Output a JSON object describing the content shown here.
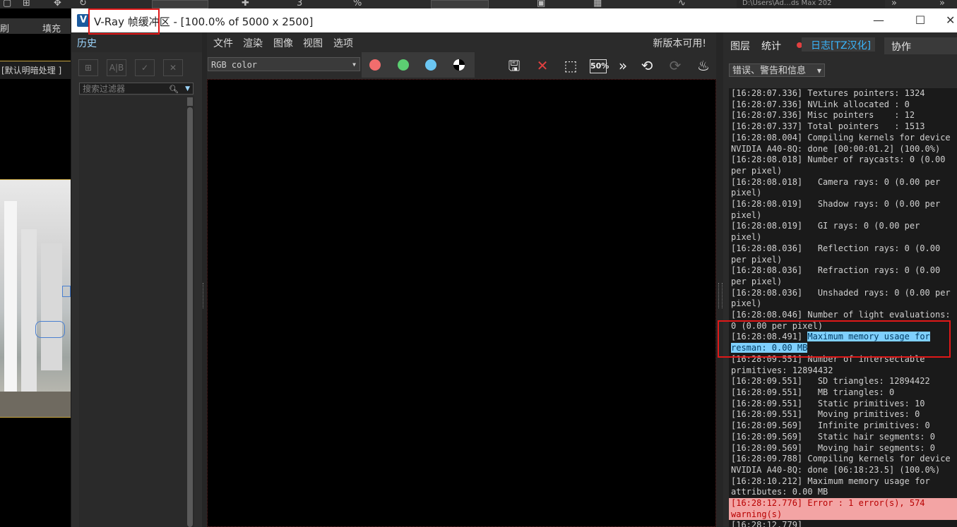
{
  "host": {
    "path_fragment": "D:\\Users\\Ad…ds Max 202",
    "left_menu": [
      "刷",
      "填充"
    ],
    "viewport_label": "[默认明暗处理 ]"
  },
  "window": {
    "title": "V-Ray 帧缓冲区 - [100.0% of 5000 x 2500]",
    "logo": "V",
    "minimize": "—",
    "maximize": "☐",
    "close": "✕"
  },
  "history": {
    "tab": "历史",
    "search_placeholder": "搜索过滤器"
  },
  "menu": {
    "items": [
      "文件",
      "渲染",
      "图像",
      "视图",
      "选项"
    ],
    "update_notice": "新版本可用!"
  },
  "toolbar": {
    "channel": "RGB color",
    "zoom_label": "50%",
    "colors": {
      "red": "#f26d6d",
      "green": "#5ccf72",
      "blue": "#6bc6f2"
    }
  },
  "log_panel": {
    "tabs": [
      "图层",
      "统计",
      "日志[TZ汉化]",
      "协作"
    ],
    "filter": "错误、警告和信息",
    "lines": [
      {
        "text": "[16:28:07.336] Textures pointers: 1324"
      },
      {
        "text": "[16:28:07.336] NVLink allocated : 0"
      },
      {
        "text": "[16:28:07.336] Misc pointers    : 12"
      },
      {
        "text": "[16:28:07.337] Total pointers   : 1513"
      },
      {
        "text": "[16:28:08.004] Compiling kernels for device"
      },
      {
        "text": "NVIDIA A40-8Q: done [00:00:01.2] (100.0%)"
      },
      {
        "text": "[16:28:08.018] Number of raycasts: 0 (0.00"
      },
      {
        "text": "per pixel)"
      },
      {
        "text": "[16:28:08.018]   Camera rays: 0 (0.00 per"
      },
      {
        "text": "pixel)"
      },
      {
        "text": "[16:28:08.019]   Shadow rays: 0 (0.00 per"
      },
      {
        "text": "pixel)"
      },
      {
        "text": "[16:28:08.019]   GI rays: 0 (0.00 per"
      },
      {
        "text": "pixel)"
      },
      {
        "text": "[16:28:08.036]   Reflection rays: 0 (0.00"
      },
      {
        "text": "per pixel)"
      },
      {
        "text": "[16:28:08.036]   Refraction rays: 0 (0.00"
      },
      {
        "text": "per pixel)"
      },
      {
        "text": "[16:28:08.036]   Unshaded rays: 0 (0.00 per"
      },
      {
        "text": "pixel)"
      },
      {
        "text": "[16:28:08.046] Number of light evaluations:"
      },
      {
        "text": "0 (0.00 per pixel)"
      },
      {
        "prefix": "[16:28:08.491] ",
        "selected": "Maximum memory usage for"
      },
      {
        "prefix": "",
        "selected": "resman: 0.00 MB"
      },
      {
        "text": "[16:28:09.551] Number of intersectable"
      },
      {
        "text": "primitives: 12894432"
      },
      {
        "text": "[16:28:09.551]   SD triangles: 12894422"
      },
      {
        "text": "[16:28:09.551]   MB triangles: 0"
      },
      {
        "text": "[16:28:09.551]   Static primitives: 10"
      },
      {
        "text": "[16:28:09.551]   Moving primitives: 0"
      },
      {
        "text": "[16:28:09.569]   Infinite primitives: 0"
      },
      {
        "text": "[16:28:09.569]   Static hair segments: 0"
      },
      {
        "text": "[16:28:09.569]   Moving hair segments: 0"
      },
      {
        "text": "[16:28:09.788] Compiling kernels for device"
      },
      {
        "text": "NVIDIA A40-8Q: done [06:18:23.5] (100.0%)"
      },
      {
        "text": "[16:28:10.212] Maximum memory usage for"
      },
      {
        "text": "attributes: 0.00 MB"
      },
      {
        "text": "[16:28:12.776] Error : 1 error(s), 574",
        "level": "error"
      },
      {
        "text": "warning(s)",
        "level": "error"
      },
      {
        "text": "[16:28:12.779]"
      }
    ]
  }
}
